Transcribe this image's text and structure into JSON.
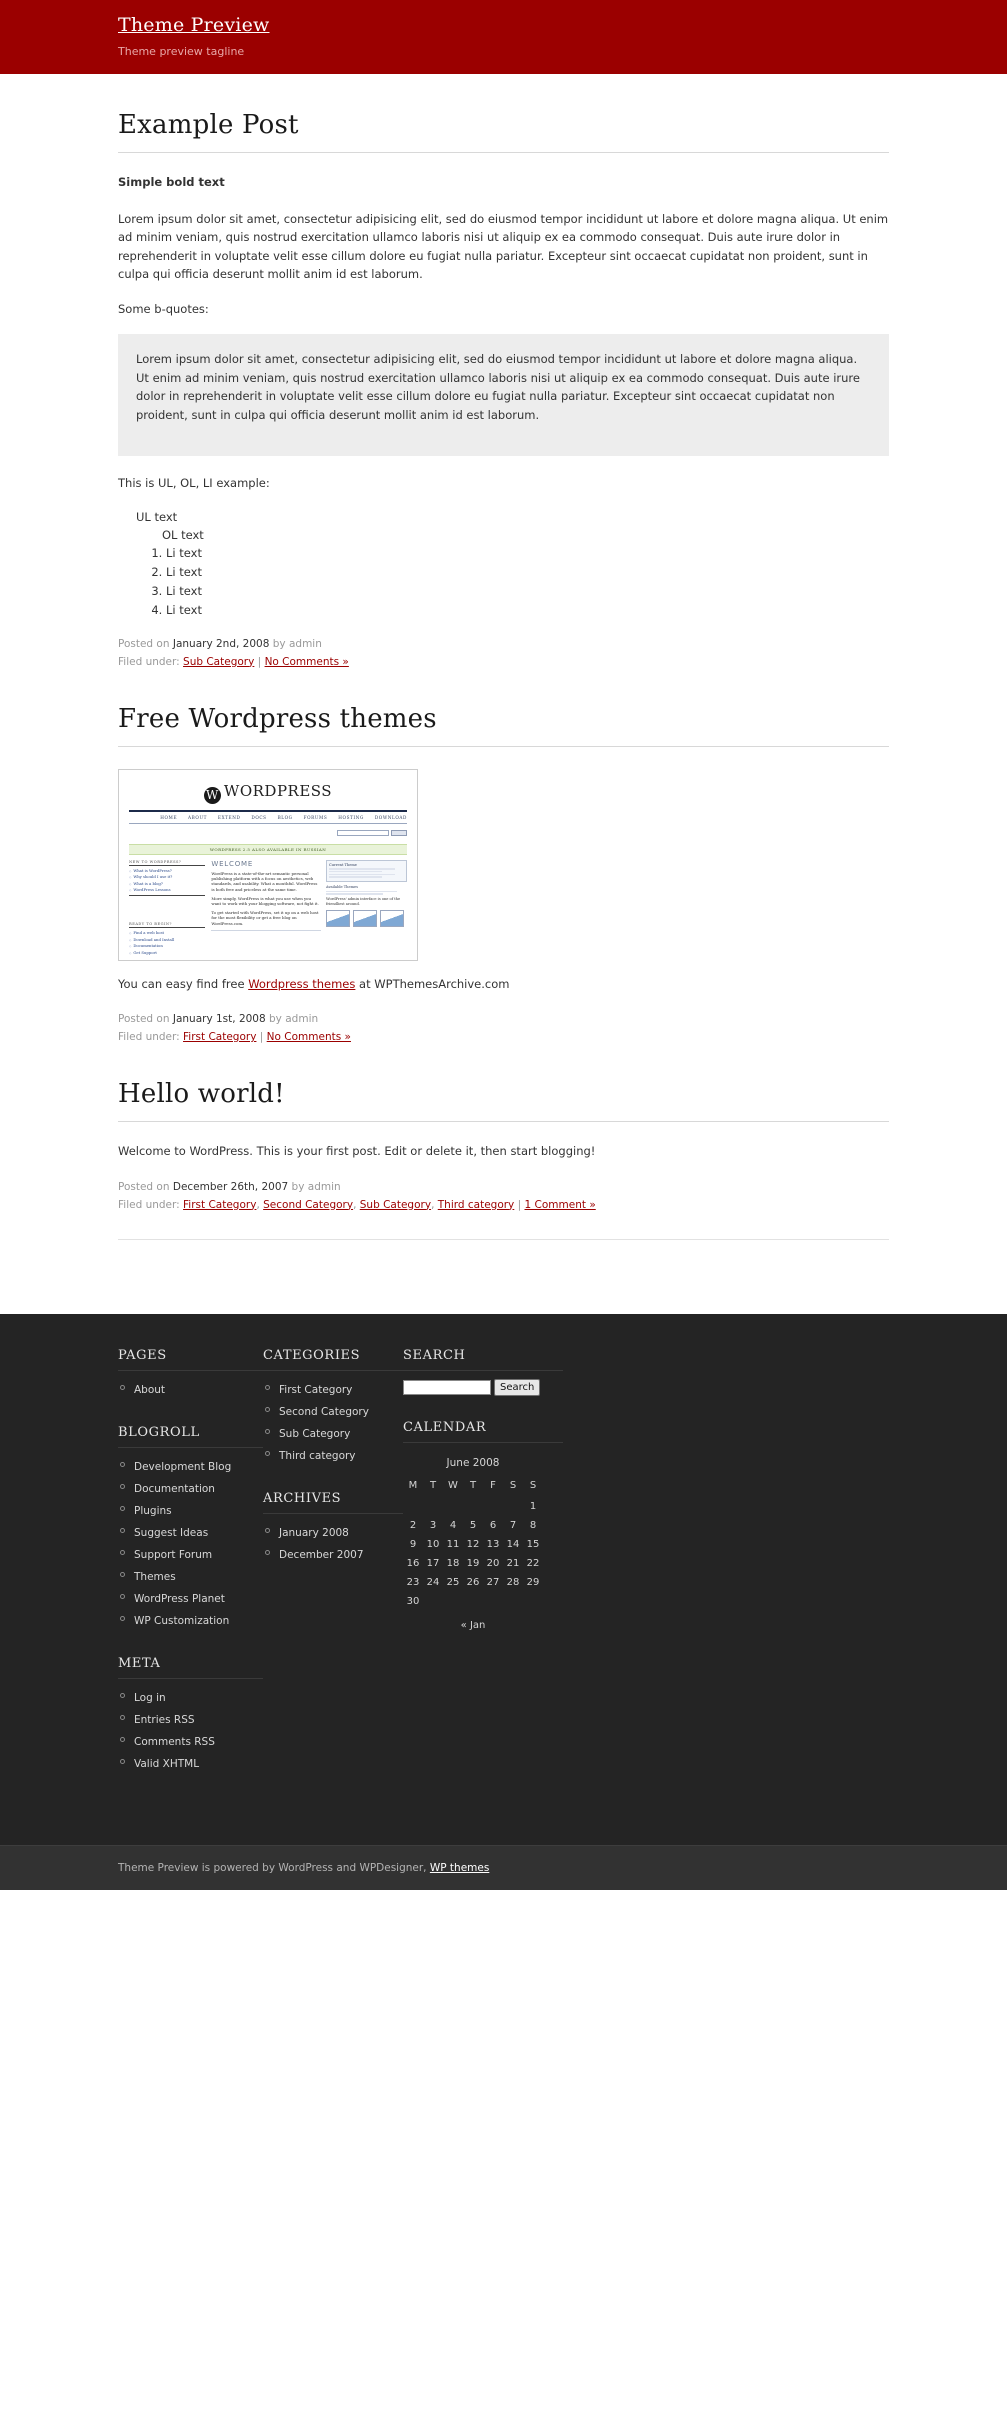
{
  "header": {
    "title": "Theme Preview",
    "tagline": "Theme preview tagline"
  },
  "posts": [
    {
      "title": "Example Post",
      "bold_text": "Simple bold text",
      "paragraph": "Lorem ipsum dolor sit amet, consectetur adipisicing elit, sed do eiusmod tempor incididunt ut labore et dolore magna aliqua. Ut enim ad minim veniam, quis nostrud exercitation ullamco laboris nisi ut aliquip ex ea commodo consequat. Duis aute irure dolor in reprehenderit in voluptate velit esse cillum dolore eu fugiat nulla pariatur. Excepteur sint occaecat cupidatat non proident, sunt in culpa qui officia deserunt mollit anim id est laborum.",
      "quote_intro": "Some b-quotes:",
      "blockquote": "Lorem ipsum dolor sit amet, consectetur adipisicing elit, sed do eiusmod tempor incididunt ut labore et dolore magna aliqua. Ut enim ad minim veniam, quis nostrud exercitation ullamco laboris nisi ut aliquip ex ea commodo consequat. Duis aute irure dolor in reprehenderit in voluptate velit esse cillum dolore eu fugiat nulla pariatur. Excepteur sint occaecat cupidatat non proident, sunt in culpa qui officia deserunt mollit anim id est laborum.",
      "list_intro": "This is UL, OL, LI example:",
      "ul_text": "UL text",
      "ol_text": "OL text",
      "li_items": [
        "Li text",
        "Li text",
        "Li text",
        "Li text"
      ],
      "posted_prefix": "Posted on",
      "date": "January 2nd, 2008",
      "by": "by",
      "author": "admin",
      "filed_label": "Filed under:",
      "categories": [
        "Sub Category"
      ],
      "comments": "No Comments »"
    },
    {
      "title": "Free Wordpress themes",
      "caption_pre": "You can easy find free ",
      "caption_link": "Wordpress themes",
      "caption_post": " at WPThemesArchive.com",
      "posted_prefix": "Posted on",
      "date": "January 1st, 2008",
      "by": "by",
      "author": "admin",
      "filed_label": "Filed under:",
      "categories": [
        "First Category"
      ],
      "comments": "No Comments »"
    },
    {
      "title": "Hello world!",
      "paragraph": "Welcome to WordPress. This is your first post. Edit or delete it, then start blogging!",
      "posted_prefix": "Posted on",
      "date": "December 26th, 2007",
      "by": "by",
      "author": "admin",
      "filed_label": "Filed under:",
      "categories": [
        "First Category",
        "Second Category",
        "Sub Category",
        "Third category"
      ],
      "comments": "1 Comment »"
    }
  ],
  "wp_screenshot": {
    "logo_text": "WORDPRESS",
    "nav": [
      "HOME",
      "ABOUT",
      "EXTEND",
      "DOCS",
      "BLOG",
      "FORUMS",
      "HOSTING",
      "DOWNLOAD"
    ],
    "search_button": "Search",
    "notice": "WORDPRESS 2.5 ALSO AVAILABLE IN RUSSIAN",
    "welcome": "WELCOME",
    "box1_title": "NEW TO WORDPRESS?",
    "box1_links": [
      "What is WordPress?",
      "Why should I use it?",
      "What is a blog?",
      "WordPress Lessons"
    ],
    "box2_title": "READY TO BEGIN?",
    "box2_links": [
      "Find a web host",
      "Download and Install",
      "Documentation",
      "Get Support"
    ],
    "para1": "WordPress is a state-of-the-art semantic personal publishing platform with a focus on aesthetics, web standards, and usability. What a mouthful. WordPress is both free and priceless at the same time.",
    "para2": "More simply, WordPress is what you use when you want to work with your blogging software, not fight it.",
    "para3": "To get started with WordPress, set it up on a web host for the most flexibility or get a free blog on WordPress.com.",
    "panel_title": "Current Theme",
    "panel_sub": "Available Themes",
    "thumbs_caption": "WordPress' admin interface is one of the friendliest around."
  },
  "footer": {
    "pages": {
      "title": "PAGES",
      "items": [
        "About"
      ]
    },
    "blogroll": {
      "title": "BLOGROLL",
      "items": [
        "Development Blog",
        "Documentation",
        "Plugins",
        "Suggest Ideas",
        "Support Forum",
        "Themes",
        "WordPress Planet",
        "WP Customization"
      ]
    },
    "meta": {
      "title": "META",
      "items": [
        "Log in",
        "Entries RSS",
        "Comments RSS",
        "Valid XHTML"
      ]
    },
    "categories": {
      "title": "CATEGORIES",
      "items": [
        "First Category",
        "Second Category",
        "Sub Category",
        "Third category"
      ]
    },
    "archives": {
      "title": "ARCHIVES",
      "items": [
        "January 2008",
        "December 2007"
      ]
    },
    "search": {
      "title": "SEARCH",
      "value": "",
      "placeholder": "",
      "button": "Search"
    },
    "calendar": {
      "title": "CALENDAR",
      "caption": "June 2008",
      "weekdays": [
        "M",
        "T",
        "W",
        "T",
        "F",
        "S",
        "S"
      ],
      "weeks": [
        [
          "",
          "",
          "",
          "",
          "",
          "",
          "1"
        ],
        [
          "2",
          "3",
          "4",
          "5",
          "6",
          "7",
          "8"
        ],
        [
          "9",
          "10",
          "11",
          "12",
          "13",
          "14",
          "15"
        ],
        [
          "16",
          "17",
          "18",
          "19",
          "20",
          "21",
          "22"
        ],
        [
          "23",
          "24",
          "25",
          "26",
          "27",
          "28",
          "29"
        ],
        [
          "30",
          "",
          "",
          "",
          "",
          "",
          ""
        ]
      ],
      "prev_link": "« Jan"
    }
  },
  "credit": {
    "pre": "Theme Preview is powered by WordPress and WPDesigner, ",
    "link": "WP themes"
  },
  "colors": {
    "header_bg": "#9b0000",
    "link": "#9b0000",
    "footer_bg": "#242424",
    "credit_bg": "#323232",
    "quote_bg": "#ededed"
  }
}
